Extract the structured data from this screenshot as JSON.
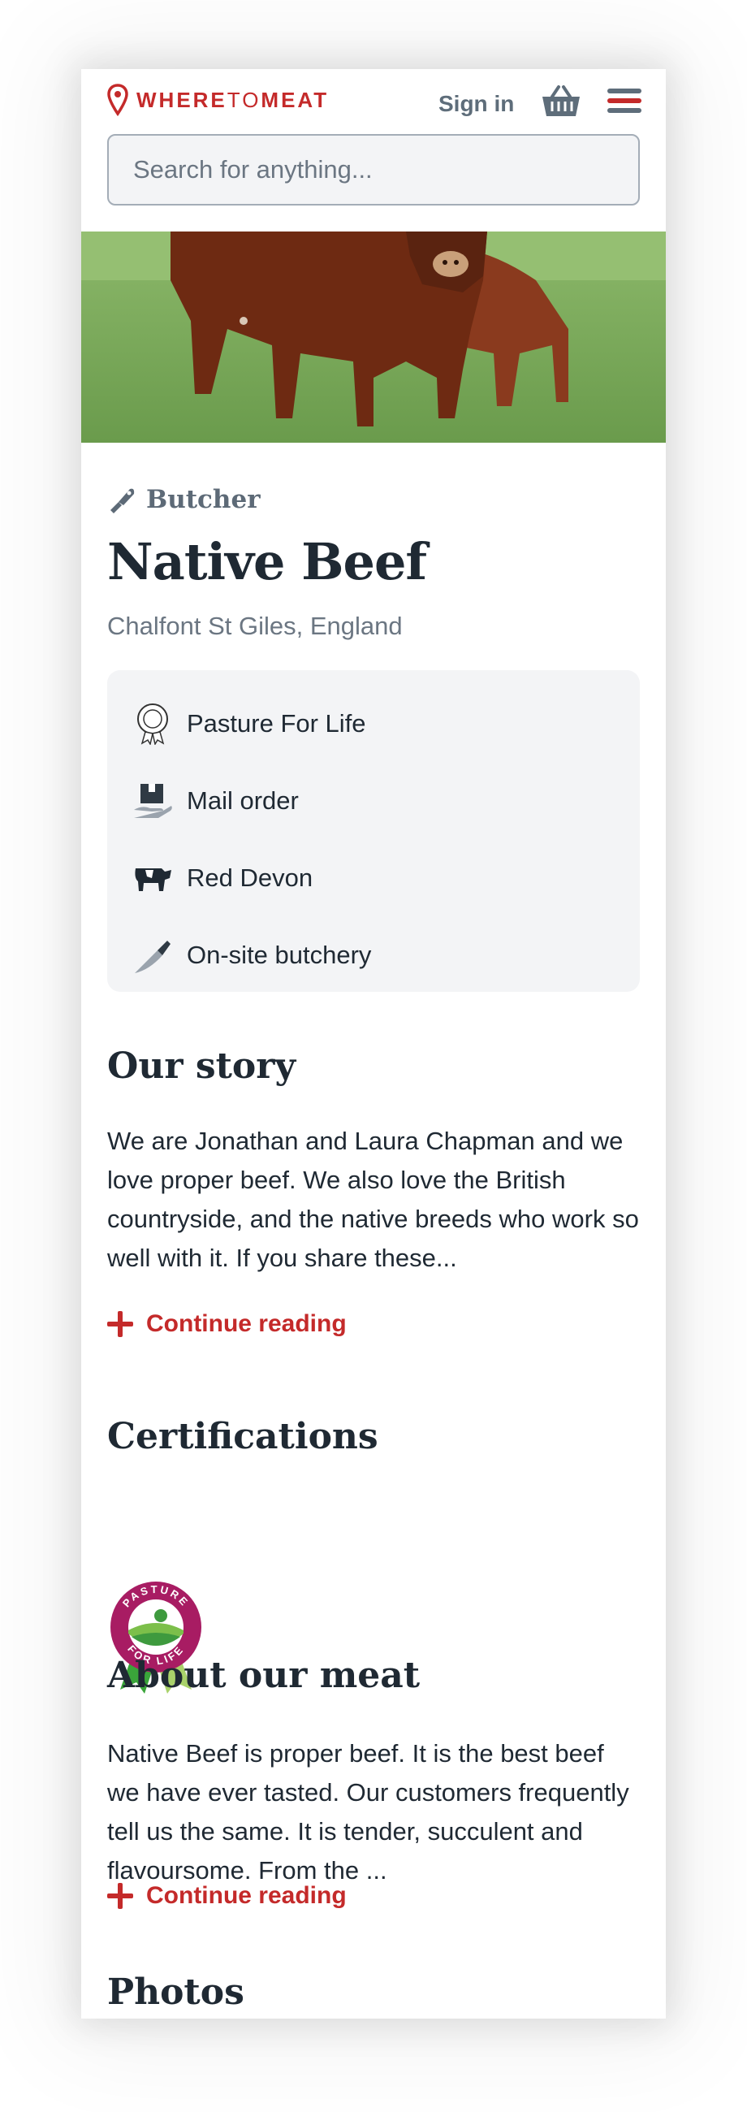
{
  "brand": {
    "name_part1": "WHERE",
    "name_part2": "TO",
    "name_part3": "MEAT"
  },
  "header": {
    "signin_label": "Sign in"
  },
  "search": {
    "placeholder": "Search for anything..."
  },
  "colors": {
    "accent": "#c42a2a",
    "muted": "#5e6d7a",
    "panel": "#f3f4f6"
  },
  "listing": {
    "category": "Butcher",
    "category_icon": "cleaver-icon",
    "title": "Native Beef",
    "location": "Chalfont St Giles, England"
  },
  "features": [
    {
      "label": "Pasture For Life",
      "icon": "pasture-badge-icon"
    },
    {
      "label": "Mail order",
      "icon": "parcel-hand-icon"
    },
    {
      "label": "Red Devon",
      "icon": "cow-icon"
    },
    {
      "label": "On-site butchery",
      "icon": "knife-icon"
    }
  ],
  "story": {
    "heading": "Our story",
    "text": "We are Jonathan and Laura Chapman and we love proper beef. We also love the British countryside, and the native breeds who work so well with it. If you share these...",
    "more_label": "Continue reading"
  },
  "certifications": {
    "heading": "Certifications",
    "badge_text_top": "PASTURE",
    "badge_text_bottom": "FOR LIFE"
  },
  "about": {
    "heading": "About our meat",
    "text": "Native Beef is proper beef. It is the best beef we have ever tasted. Our customers frequently tell us the same. It is tender, succulent and flavoursome. From the ...",
    "more_label": "Continue reading"
  },
  "next_section": {
    "heading": "Photos"
  }
}
